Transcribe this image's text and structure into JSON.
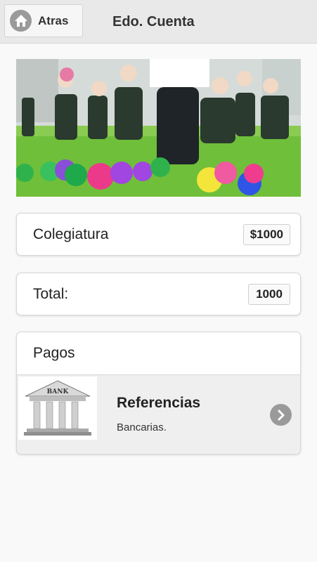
{
  "header": {
    "back_label": "Atras",
    "title": "Edo. Cuenta"
  },
  "colegiatura": {
    "label": "Colegiatura",
    "amount": "$1000"
  },
  "total": {
    "label": "Total:",
    "amount": "1000"
  },
  "pagos": {
    "heading": "Pagos",
    "items": [
      {
        "title": "Referencias",
        "subtitle": "Bancarias.",
        "thumb_text": "BANK"
      }
    ]
  },
  "icons": {
    "back": "home-icon",
    "item_arrow": "chevron-right-icon"
  },
  "colors": {
    "header_bg": "#e9e9e9",
    "page_bg": "#f9f9f9",
    "icon_gray": "#9a9a9a"
  }
}
